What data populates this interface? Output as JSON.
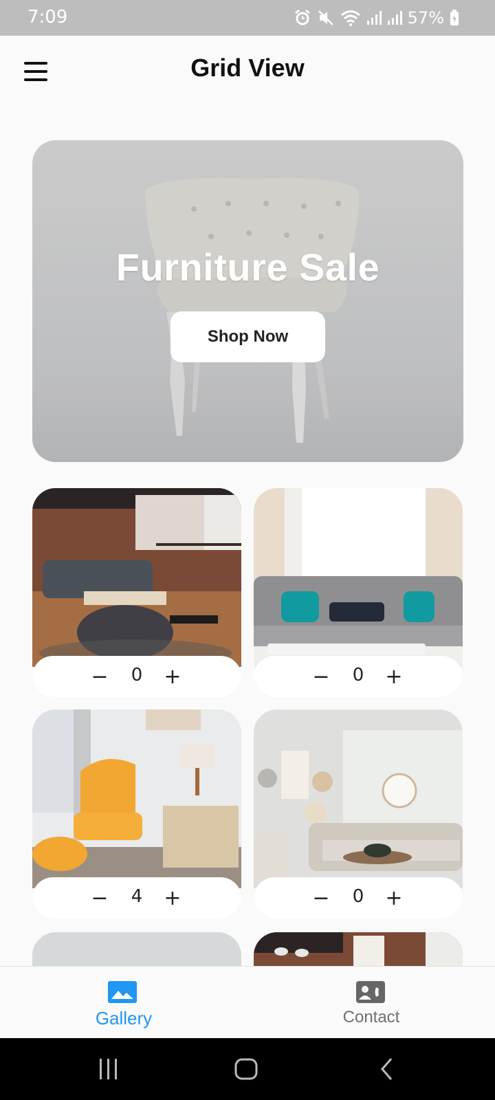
{
  "status_bar": {
    "time": "7:09",
    "battery": "57%"
  },
  "app_bar": {
    "title": "Grid View",
    "menu_icon": "hamburger-menu-icon"
  },
  "hero": {
    "title": "Furniture Sale",
    "button_label": "Shop Now"
  },
  "stepper_symbols": {
    "minus": "−",
    "plus": "+"
  },
  "products": [
    {
      "quantity": "0",
      "image": "living-room-gray-sofa"
    },
    {
      "quantity": "0",
      "image": "gray-sofa-teal-pillows"
    },
    {
      "quantity": "4",
      "image": "yellow-armchair"
    },
    {
      "quantity": "0",
      "image": "beige-sectional-living-room"
    }
  ],
  "bottom_nav": [
    {
      "label": "Gallery",
      "icon": "gallery-icon",
      "active": true,
      "color": "#2196f3"
    },
    {
      "label": "Contact",
      "icon": "contact-card-icon",
      "active": false,
      "color": "#707070"
    }
  ],
  "system_nav": [
    "recent-apps-icon",
    "home-icon",
    "back-icon"
  ]
}
